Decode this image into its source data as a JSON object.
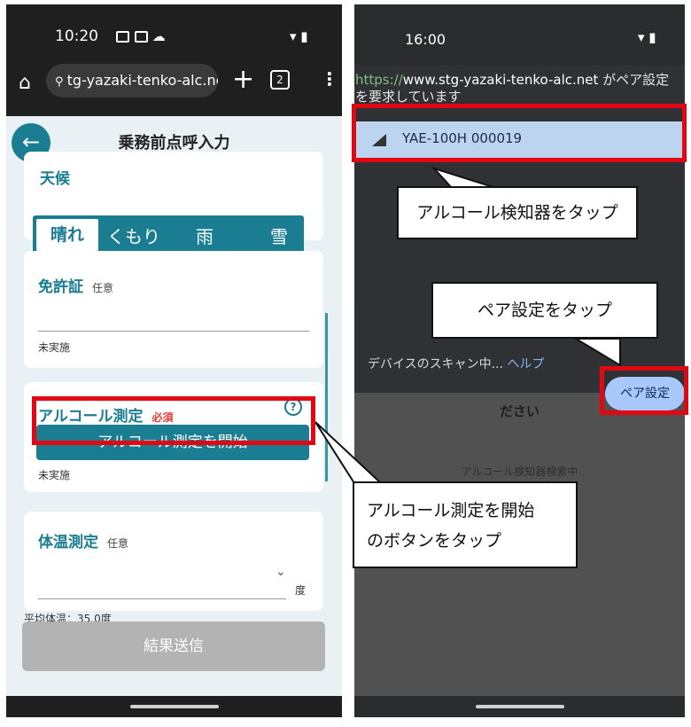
{
  "left_phone": {
    "status_time": "10:20",
    "url": "tg-yazaki-tenko-alc.net",
    "tab_count": "2",
    "page_title": "乗務前点呼入力",
    "weather": {
      "label": "天候",
      "options": [
        "晴れ",
        "くもり",
        "雨",
        "雪"
      ],
      "selected": "晴れ"
    },
    "license": {
      "label": "免許証",
      "tag": "任意",
      "status": "未実施"
    },
    "alcohol": {
      "label": "アルコール測定",
      "tag": "必須",
      "button": "アルコール測定を開始",
      "status": "未実施",
      "help_icon": "?"
    },
    "temperature": {
      "label": "体温測定",
      "tag": "任意",
      "unit": "度",
      "average": "平均体温：35.0度"
    },
    "submit": "結果送信"
  },
  "right_phone": {
    "status_time": "16:00",
    "request": {
      "scheme": "https://",
      "host": "www.stg-yazaki-tenko-alc.net",
      "text": " がペア設定を要求しています"
    },
    "device_name": "YAE-100H 000019",
    "scanning": "デバイスのスキャン中...",
    "help_link": "ヘルプ",
    "pair_button": "ペア設定",
    "background_text_1": "ださい",
    "background_text_2": "アルコール検知器検索中"
  },
  "annotations": {
    "callout_device": "アルコール検知器をタップ",
    "callout_pair": "ペア設定をタップ",
    "callout_start_line1": "アルコール測定を開始",
    "callout_start_line2": "のボタンをタップ"
  },
  "colors": {
    "accent": "#1a7d91",
    "annotation_red": "#e30613",
    "device_row": "#bcd4f0",
    "pair_button": "#a8c7fa"
  }
}
